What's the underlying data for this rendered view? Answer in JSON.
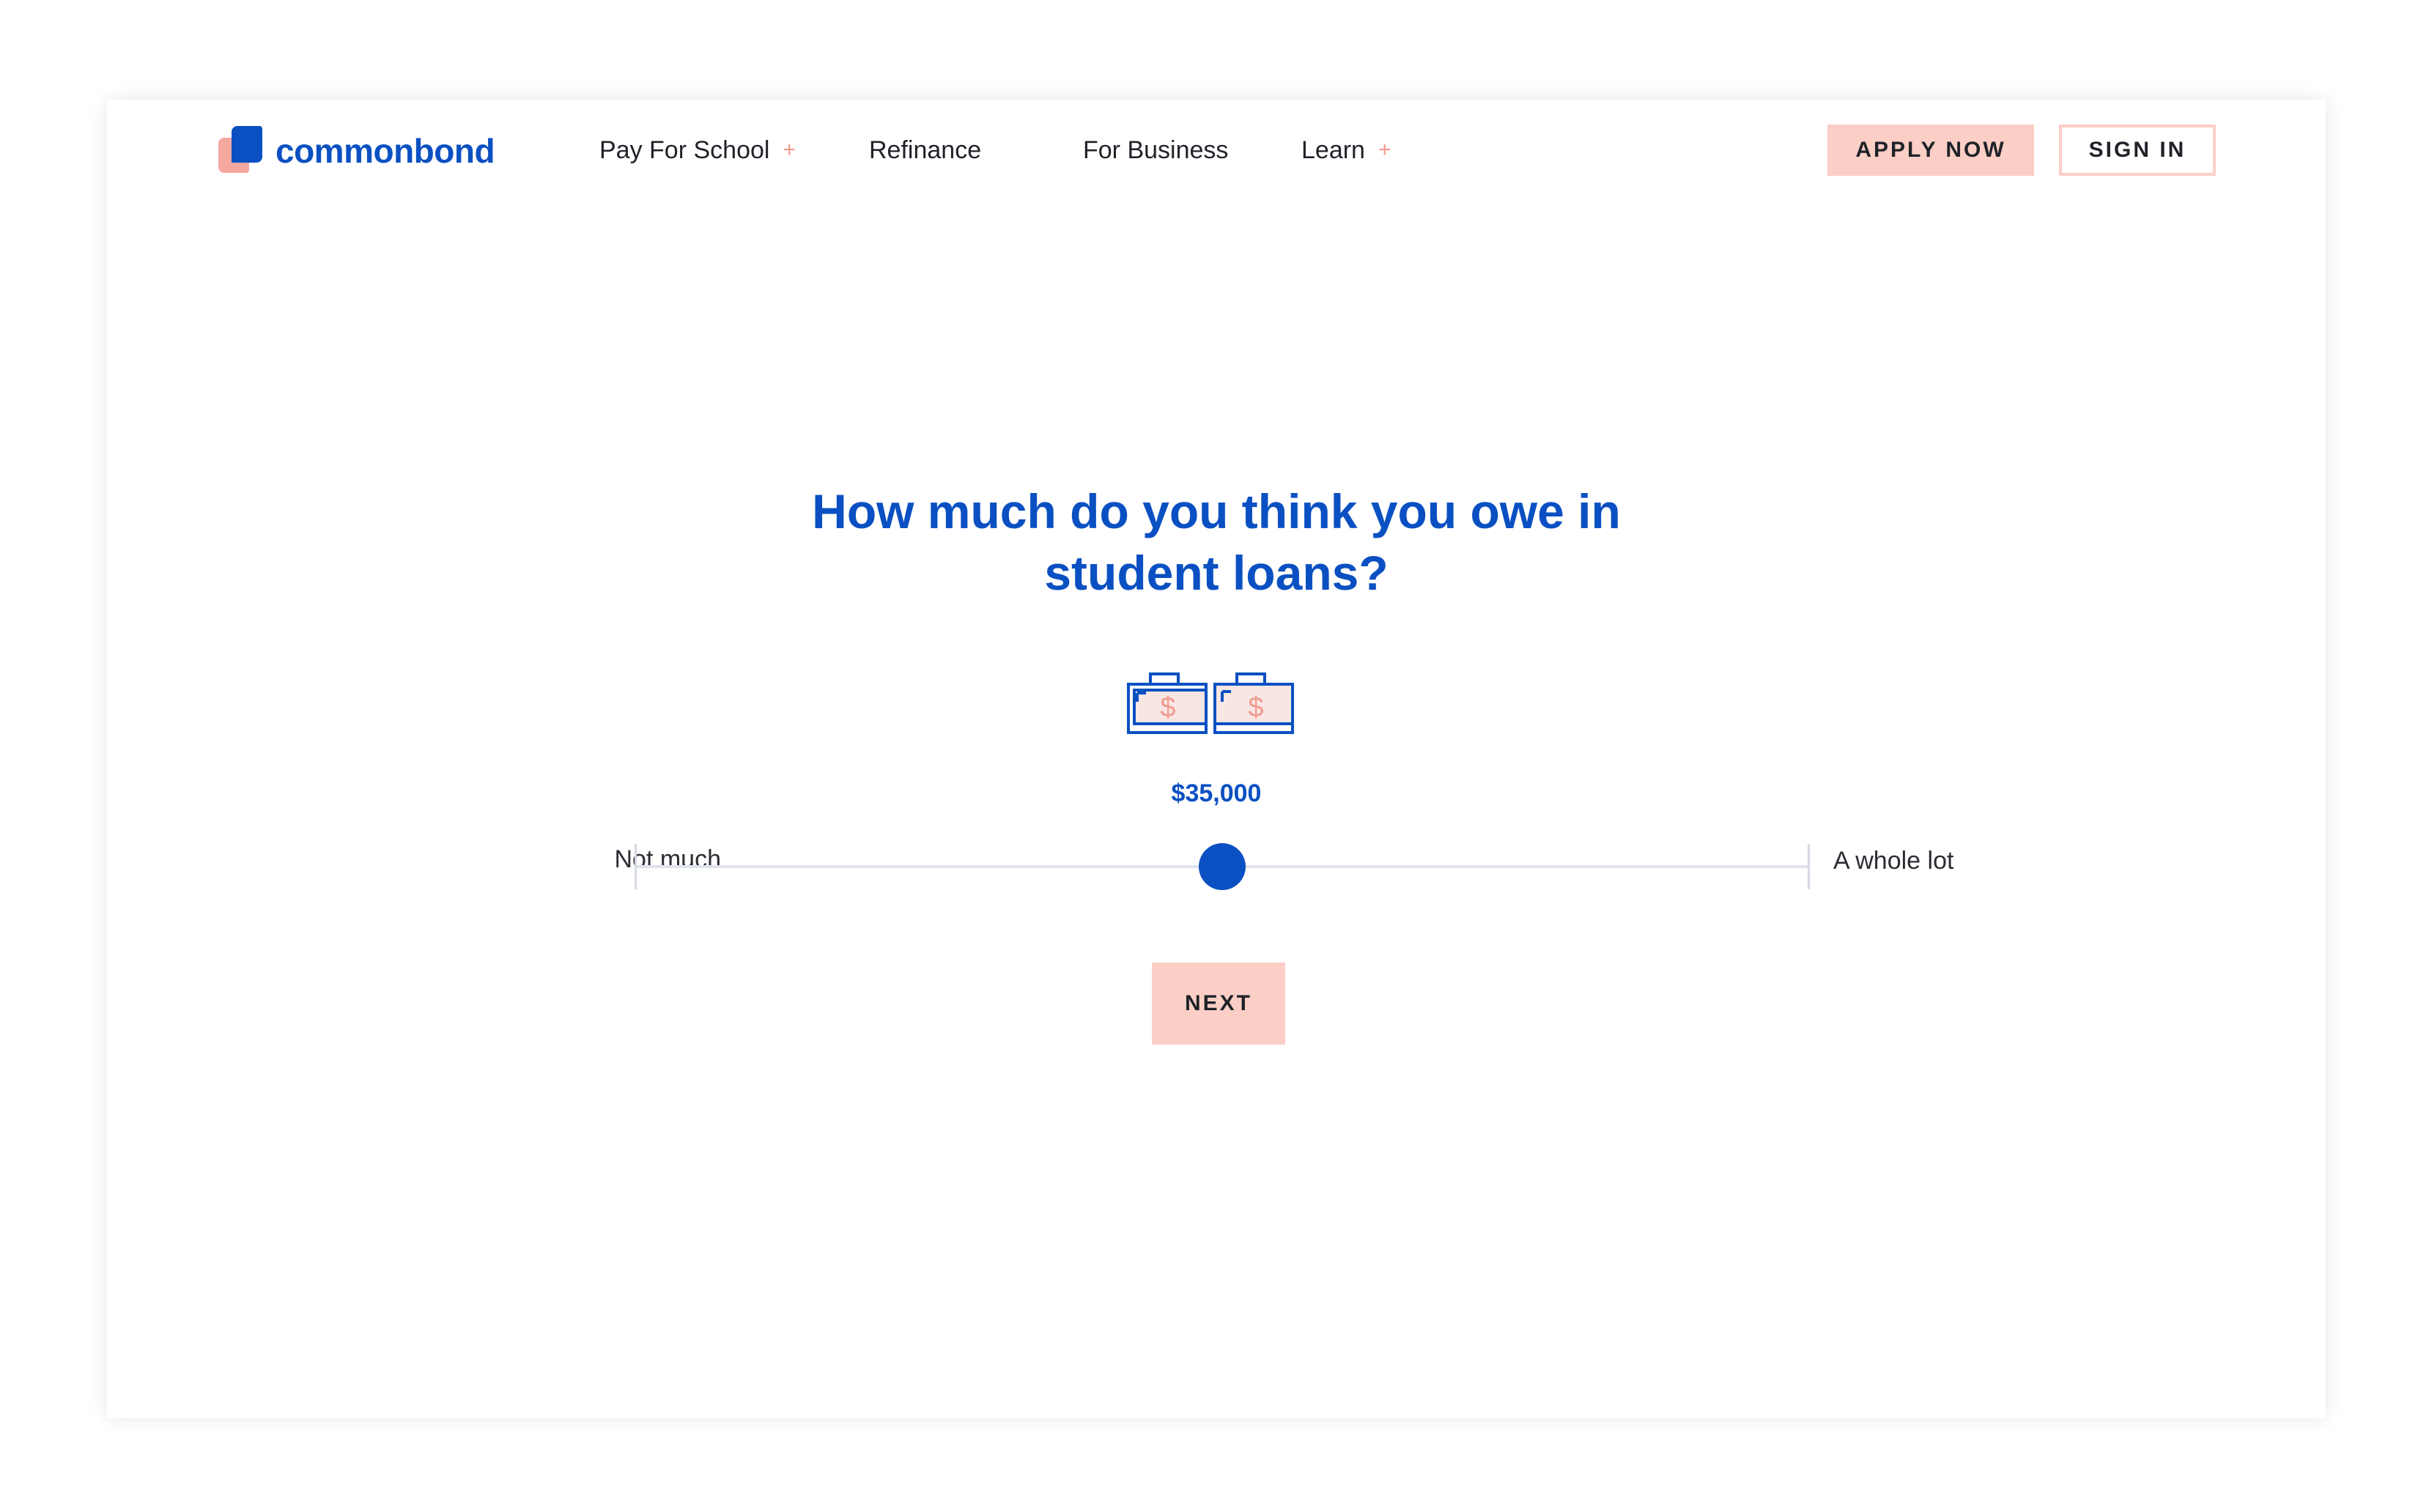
{
  "brand": {
    "name": "commonbond"
  },
  "nav": {
    "items": [
      {
        "label": "Pay For School",
        "has_submenu": true
      },
      {
        "label": "Refinance",
        "has_submenu": false
      },
      {
        "label": "For Business",
        "has_submenu": false
      },
      {
        "label": "Learn",
        "has_submenu": true
      }
    ],
    "submenu_glyph": "+"
  },
  "header": {
    "apply_label": "APPLY NOW",
    "signin_label": "SIGN IN"
  },
  "main": {
    "question_line1": "How much do you think you owe in",
    "question_line2": "student loans?",
    "icon": "briefcase-dollar-icon",
    "icon_count": 2,
    "amount": "$35,000",
    "slider_min_label": "Not much",
    "slider_max_label": "A whole lot",
    "slider_value": 0.5,
    "next_label": "NEXT"
  },
  "colors": {
    "brand_blue": "#0a50c2",
    "accent_pink": "#fccfc6",
    "plus_pink": "#f39b8f"
  }
}
